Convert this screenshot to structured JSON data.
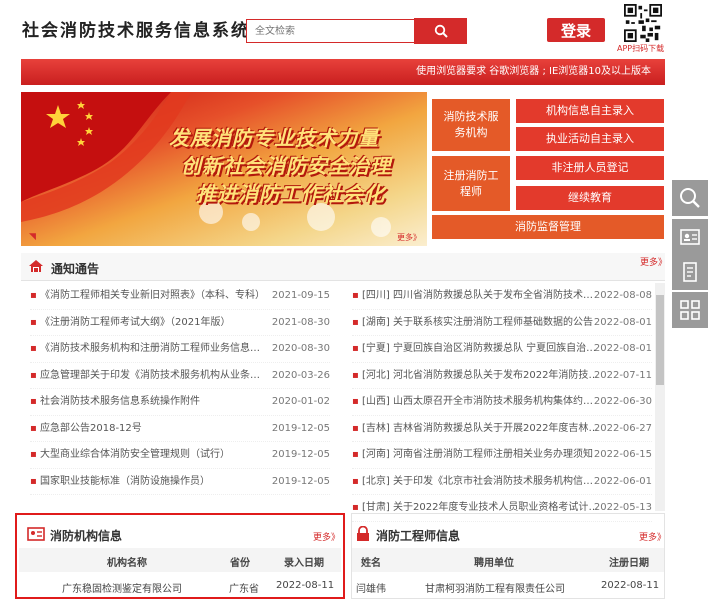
{
  "header": {
    "site_title": "社会消防技术服务信息系统",
    "search_placeholder": "全文检索",
    "login_label": "登录",
    "qr_label": "APP扫码下载"
  },
  "browser_notice": "使用浏览器要求 谷歌浏览器 ; IE浏览器10及以上版本",
  "banner": {
    "slogans": [
      "发展消防专业技术力量",
      "创新社会消防安全治理",
      "推进消防工作社会化"
    ],
    "more": "更多》"
  },
  "quick_links": {
    "org": "消防技术服务机构",
    "engineer": "注册消防工程师",
    "org_self_entry": "机构信息自主录入",
    "practice_self_entry": "执业活动自主录入",
    "non_registered": "非注册人员登记",
    "continuing_edu": "继续教育",
    "fire_supervision": "消防监督管理"
  },
  "notices": {
    "title": "通知通告",
    "more": "更多》",
    "left": [
      {
        "text": "《消防工程师相关专业新旧对照表》（本科、专科）",
        "date": "2021-09-15"
      },
      {
        "text": "《注册消防工程师考试大纲》（2021年版）",
        "date": "2021-08-30"
      },
      {
        "text": "《消防技术服务机构和注册消防工程师业务信息管理系...",
        "date": "2020-08-30"
      },
      {
        "text": "应急管理部关于印发《消防技术服务机构从业条件》的...",
        "date": "2020-03-26"
      },
      {
        "text": "社会消防技术服务信息系统操作附件",
        "date": "2020-01-02"
      },
      {
        "text": "应急部公告2018-12号",
        "date": "2019-12-05"
      },
      {
        "text": "大型商业综合体消防安全管理规则（试行）",
        "date": "2019-12-05"
      },
      {
        "text": "国家职业技能标准（消防设施操作员）",
        "date": "2019-12-05"
      }
    ],
    "right": [
      {
        "text": "[四川] 四川省消防救援总队关于发布全省消防技术服务...",
        "date": "2022-08-08"
      },
      {
        "text": "[湖南] 关于联系核实注册消防工程师基础数据的公告",
        "date": "2022-08-01"
      },
      {
        "text": "[宁夏] 宁夏回族自治区消防救援总队 宁夏回族自治区...",
        "date": "2022-08-01"
      },
      {
        "text": "[河北] 河北省消防救援总队关于发布2022年消防技术...",
        "date": "2022-07-11"
      },
      {
        "text": "[山西] 山西太原召开全市消防技术服务机构集体约谈暨...",
        "date": "2022-06-30"
      },
      {
        "text": "[吉林] 吉林省消防救援总队关于开展2022年度吉林省...",
        "date": "2022-06-27"
      },
      {
        "text": "[河南] 河南省注册消防工程师注册相关业务办理须知",
        "date": "2022-06-15"
      },
      {
        "text": "[北京] 关于印发《北京市社会消防技术服务机构信用监...",
        "date": "2022-06-01"
      },
      {
        "text": "[甘肃] 关于2022年度专业技术人员职业资格考试计划...",
        "date": "2022-05-13"
      }
    ]
  },
  "org_info": {
    "title": "消防机构信息",
    "more": "更多》",
    "columns": [
      "机构名称",
      "省份",
      "录入日期"
    ],
    "rows": [
      [
        "广东稳固检测鉴定有限公司",
        "广东省",
        "2022-08-11"
      ]
    ]
  },
  "engineer_info": {
    "title": "消防工程师信息",
    "more": "更多》",
    "columns": [
      "姓名",
      "聘用单位",
      "注册日期"
    ],
    "rows": [
      [
        "闫雄伟",
        "甘肃柯羽消防工程有限责任公司",
        "2022-08-11"
      ]
    ]
  },
  "colors": {
    "brand_red": "#d42a2a",
    "link_orange": "#e45a28",
    "side_gray": "#9a9a9a"
  }
}
